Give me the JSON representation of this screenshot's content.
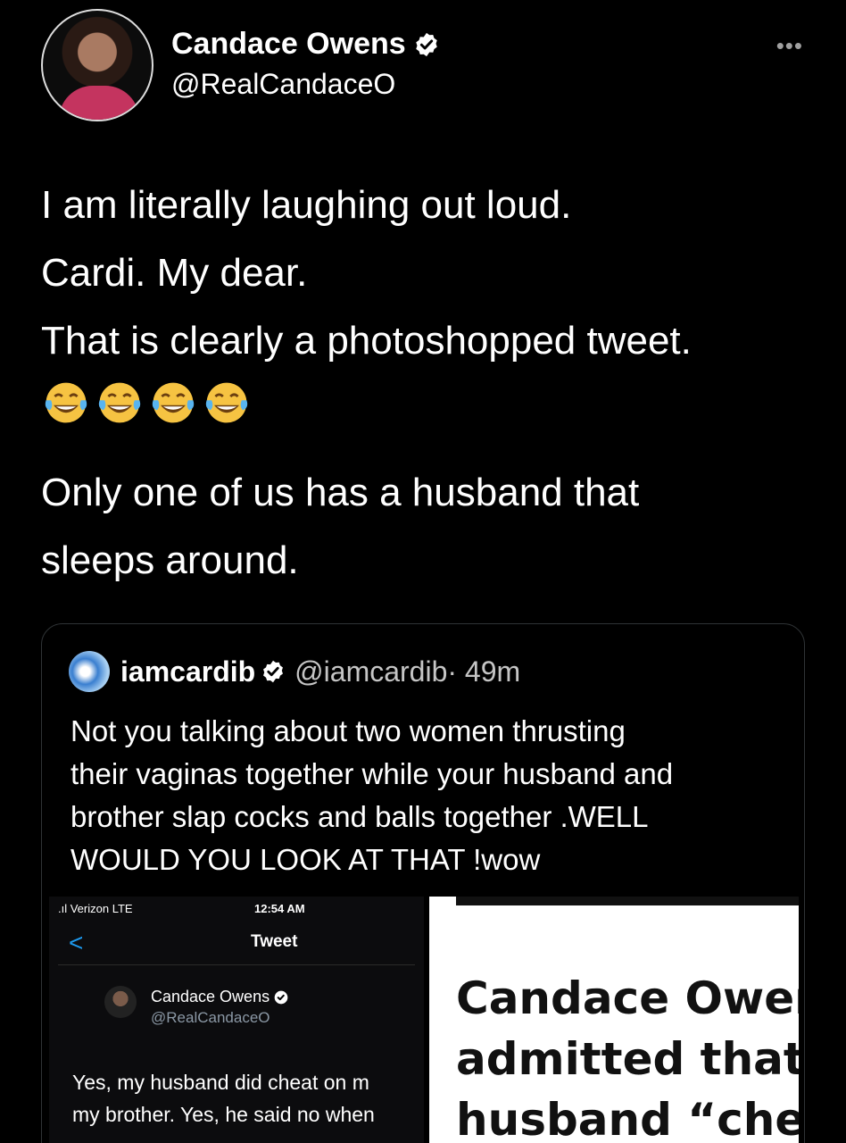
{
  "author": {
    "name": "Candace Owens",
    "handle": "@RealCandaceO"
  },
  "more_label": "•••",
  "tweet": {
    "lines": [
      "I am literally laughing out loud.",
      "Cardi. My dear.",
      "That is clearly a photoshopped tweet."
    ],
    "emojis": [
      "😂",
      "😂",
      "😂",
      "😂"
    ],
    "lines2": [
      "Only one of us has a husband that",
      "sleeps around."
    ]
  },
  "quote": {
    "name": "iamcardib",
    "handle": "@iamcardib",
    "time": "· 49m",
    "text_lines": [
      "Not you talking about two women thrusting",
      "their vaginas together while your husband and",
      "brother slap cocks and balls together .WELL",
      "WOULD YOU LOOK AT THAT !wow"
    ]
  },
  "media_phone": {
    "carrier": ".ıl Verizon  LTE",
    "clock": "12:54 AM",
    "back": "<",
    "title": "Tweet",
    "name": "Candace Owens",
    "handle": "@RealCandaceO",
    "text_lines": [
      "Yes, my husband did cheat on m",
      "my brother. Yes, he said no when"
    ]
  },
  "media_headline": {
    "lines": [
      "Candace Ower",
      "admitted that h",
      "husband “chea"
    ]
  },
  "colors": {
    "background": "#000000",
    "verified_blue": "#1d9bf0",
    "text": "#ffffff"
  }
}
